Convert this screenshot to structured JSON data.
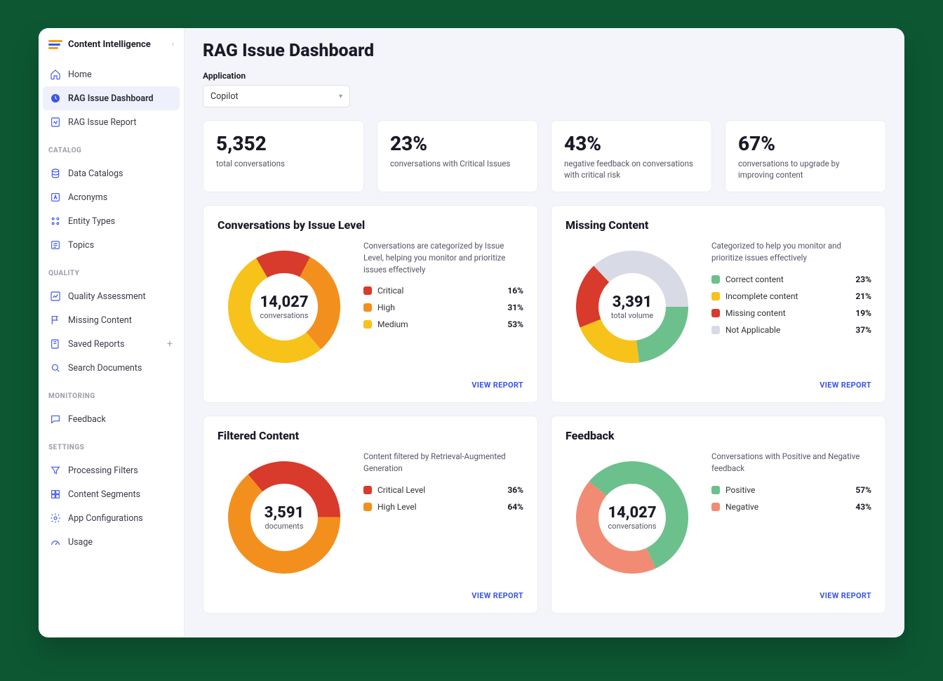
{
  "brand": {
    "title": "Content Intelligence"
  },
  "sidebar": {
    "items_top": [
      {
        "label": "Home",
        "icon": "home"
      },
      {
        "label": "RAG Issue Dashboard",
        "icon": "clock",
        "active": true
      },
      {
        "label": "RAG Issue Report",
        "icon": "report"
      }
    ],
    "catalog_label": "CATALOG",
    "items_catalog": [
      {
        "label": "Data Catalogs",
        "icon": "db"
      },
      {
        "label": "Acronyms",
        "icon": "letter"
      },
      {
        "label": "Entity Types",
        "icon": "dots"
      },
      {
        "label": "Topics",
        "icon": "topic"
      }
    ],
    "quality_label": "QUALITY",
    "items_quality": [
      {
        "label": "Quality Assessment",
        "icon": "chart"
      },
      {
        "label": "Missing Content",
        "icon": "flag"
      },
      {
        "label": "Saved Reports",
        "icon": "save",
        "plus": true
      },
      {
        "label": "Search Documents",
        "icon": "search"
      }
    ],
    "monitoring_label": "MONITORING",
    "items_monitoring": [
      {
        "label": "Feedback",
        "icon": "chat"
      }
    ],
    "settings_label": "SETTINGS",
    "items_settings": [
      {
        "label": "Processing Filters",
        "icon": "filter"
      },
      {
        "label": "Content Segments",
        "icon": "grid"
      },
      {
        "label": "App Configurations",
        "icon": "gear"
      },
      {
        "label": "Usage",
        "icon": "meter"
      }
    ]
  },
  "header": {
    "page_title": "RAG Issue Dashboard",
    "filter_label": "Application",
    "filter_value": "Copilot"
  },
  "kpis": [
    {
      "value": "5,352",
      "label": "total conversations"
    },
    {
      "value": "23%",
      "label": "conversations with Critical Issues"
    },
    {
      "value": "43%",
      "label": "negative feedback on conversations with critical risk"
    },
    {
      "value": "67%",
      "label": "conversations to upgrade by improving content"
    }
  ],
  "charts": {
    "issue_level": {
      "title": "Conversations by Issue Level",
      "center_value": "14,027",
      "center_sub": "conversations",
      "desc": "Conversations are categorized by Issue Level, helping you monitor and prioritize issues effectively",
      "items": [
        {
          "name": "Critical",
          "value": "16%",
          "color": "#d83a2b"
        },
        {
          "name": "High",
          "value": "31%",
          "color": "#f3901d"
        },
        {
          "name": "Medium",
          "value": "53%",
          "color": "#f7c21a"
        }
      ],
      "link": "VIEW REPORT"
    },
    "missing_content": {
      "title": "Missing Content",
      "center_value": "3,391",
      "center_sub": "total volume",
      "desc": "Categorized to help you monitor and prioritize issues effectively",
      "items": [
        {
          "name": "Correct content",
          "value": "23%",
          "color": "#6cc08b"
        },
        {
          "name": "Incomplete content",
          "value": "21%",
          "color": "#f7c21a"
        },
        {
          "name": "Missing content",
          "value": "19%",
          "color": "#d83a2b"
        },
        {
          "name": "Not Applicable",
          "value": "37%",
          "color": "#d8dbe5"
        }
      ],
      "link": "VIEW REPORT"
    },
    "filtered_content": {
      "title": "Filtered Content",
      "center_value": "3,591",
      "center_sub": "documents",
      "desc": "Content filtered by Retrieval-Augmented Generation",
      "items": [
        {
          "name": "Critical Level",
          "value": "36%",
          "color": "#d83a2b"
        },
        {
          "name": "High Level",
          "value": "64%",
          "color": "#f3901d"
        }
      ],
      "link": "VIEW REPORT"
    },
    "feedback": {
      "title": "Feedback",
      "center_value": "14,027",
      "center_sub": "conversations",
      "desc": "Conversations with Positive and Negative feedback",
      "items": [
        {
          "name": "Positive",
          "value": "57%",
          "color": "#6cc08b"
        },
        {
          "name": "Negative",
          "value": "43%",
          "color": "#f28b74"
        }
      ],
      "link": "VIEW REPORT"
    }
  },
  "chart_data": [
    {
      "type": "pie",
      "title": "Conversations by Issue Level",
      "categories": [
        "Critical",
        "High",
        "Medium"
      ],
      "values": [
        16,
        31,
        53
      ],
      "total": 14027
    },
    {
      "type": "pie",
      "title": "Missing Content",
      "categories": [
        "Correct content",
        "Incomplete content",
        "Missing content",
        "Not Applicable"
      ],
      "values": [
        23,
        21,
        19,
        37
      ],
      "total": 3391
    },
    {
      "type": "pie",
      "title": "Filtered Content",
      "categories": [
        "Critical Level",
        "High Level"
      ],
      "values": [
        36,
        64
      ],
      "total": 3591
    },
    {
      "type": "pie",
      "title": "Feedback",
      "categories": [
        "Positive",
        "Negative"
      ],
      "values": [
        57,
        43
      ],
      "total": 14027
    }
  ]
}
